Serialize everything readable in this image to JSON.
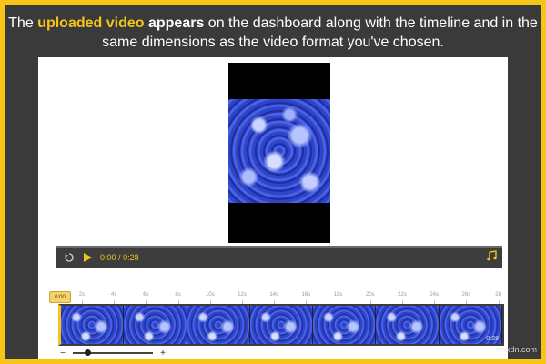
{
  "caption": {
    "part1": "The ",
    "highlight": "uploaded video",
    "part2": " ",
    "bold": "appears",
    "part3": " on the dashboard along with the timeline and in the same dimensions as the video format you've chosen."
  },
  "player": {
    "current_time": "0:00",
    "separator": "/",
    "duration": "0:28",
    "restart_icon": "restart-icon",
    "play_icon": "play-icon",
    "music_icon": "music-note-icon"
  },
  "timeline": {
    "playhead_label": "0:00",
    "ticks": [
      "2s",
      "4s",
      "6s",
      "8s",
      "10s",
      "12s",
      "14s",
      "16s",
      "18s",
      "20s",
      "22s",
      "24s",
      "26s",
      "28"
    ],
    "strip_duration": "0:28",
    "zoom_minus": "−",
    "zoom_plus": "+",
    "zoom_level": 0.15
  },
  "watermark": "wsxdn.com",
  "colors": {
    "accent": "#f5c518",
    "frame_bg": "#3a3a3a",
    "panel_bg": "#ffffff",
    "control_bar": "#3d3d3d"
  }
}
